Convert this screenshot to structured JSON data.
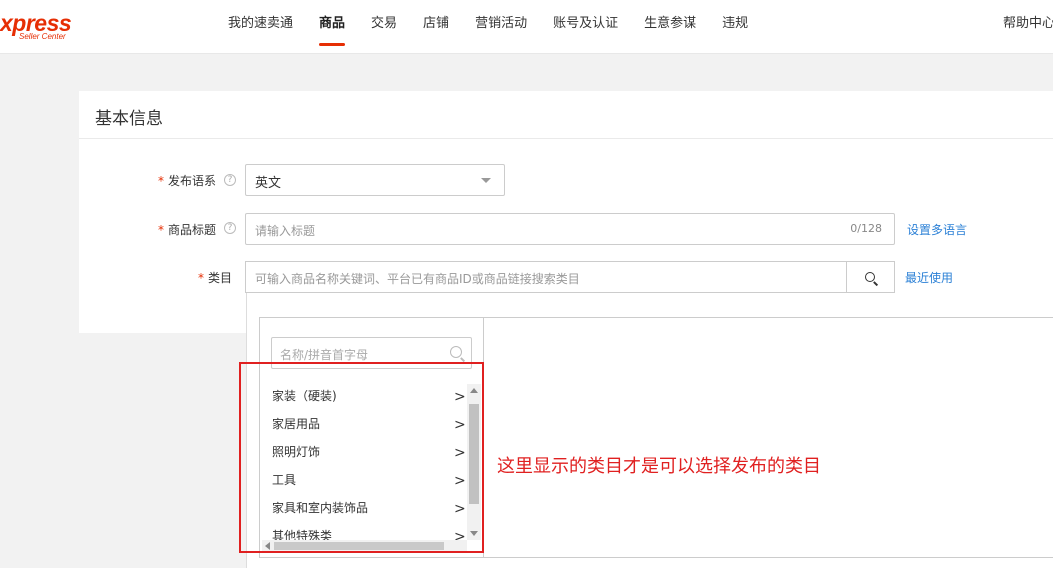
{
  "brand": {
    "logo_text": "xpress",
    "logo_sub": "Seller Center"
  },
  "nav": {
    "items": [
      {
        "label": "我的速卖通",
        "active": false
      },
      {
        "label": "商品",
        "active": true
      },
      {
        "label": "交易",
        "active": false
      },
      {
        "label": "店铺",
        "active": false
      },
      {
        "label": "营销活动",
        "active": false
      },
      {
        "label": "账号及认证",
        "active": false
      },
      {
        "label": "生意参谋",
        "active": false
      },
      {
        "label": "违规",
        "active": false
      }
    ],
    "help": "帮助中心"
  },
  "card": {
    "title": "基本信息"
  },
  "form": {
    "required_mark": "*",
    "language": {
      "label": "发布语系",
      "value": "英文"
    },
    "title": {
      "label": "商品标题",
      "placeholder": "请输入标题",
      "counter": "0/128",
      "link": "设置多语言"
    },
    "category": {
      "label": "类目",
      "placeholder": "可输入商品名称关键词、平台已有商品ID或商品链接搜索类目",
      "link": "最近使用"
    }
  },
  "category_panel": {
    "search_placeholder": "名称/拼音首字母",
    "items": [
      "家装（硬装)",
      "家居用品",
      "照明灯饰",
      "工具",
      "家具和室内装饰品",
      "其他特殊类"
    ]
  },
  "annotation": {
    "text": "这里显示的类目才是可以选择发布的类目",
    "color": "#e02020"
  },
  "colors": {
    "brand": "#e62e04",
    "link": "#2b80d6"
  }
}
